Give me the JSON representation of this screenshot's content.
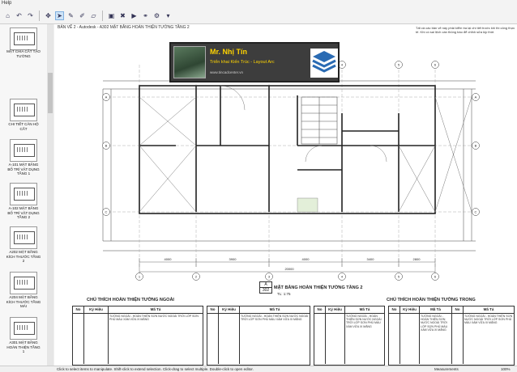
{
  "menu": {
    "help": "Help"
  },
  "toolbar": {
    "icons": [
      "home-icon",
      "back-icon",
      "forward-icon",
      "pan-icon",
      "select-icon",
      "pen-icon",
      "brush-icon",
      "eraser-icon",
      "image-icon",
      "delete-icon",
      "play-icon",
      "link-icon",
      "settings-icon"
    ]
  },
  "sidebar": {
    "thumbnails": [
      {
        "caption": ""
      },
      {
        "caption": "MẶT CHIA CẮT TẠO TƯỜNG"
      },
      {
        "caption": "CHI TIẾT CĂN HỘ CẤT"
      },
      {
        "caption": "A-101 MẶT BẰNG BỐ TRÍ VẬT DỤNG TẦNG 1"
      },
      {
        "caption": "A-102 MẶT BẰNG BỐ TRÍ VẬT DỤNG TẦNG 2"
      },
      {
        "caption": "A202 MẶT BẰNG KÍCH THƯỚC TẦNG 2"
      },
      {
        "caption": "A204 MẶT BẰNG KÍCH THƯỚC TẦNG MÁI"
      },
      {
        "caption": "A301 MẶT BẰNG HOÀN THIỆN TẦNG 1"
      }
    ]
  },
  "canvas": {
    "tab_label": "BẢN VẼ 2 - Autodesk - A302 MẶT BẰNG HOÀN THIỆN TƯỜNG TẦNG 2"
  },
  "banner": {
    "name": "Mr. Nhị Tín",
    "role": "Triển khai Kiến Trúc - Layout Arc",
    "site": "www.tincadcenter.vn"
  },
  "sheet": {
    "code": "A",
    "number": "302",
    "title": "MẶT BẰNG HOÀN THIỆN TƯỜNG TẦNG 2",
    "scale": "TL: 1:75"
  },
  "grid": {
    "columns": [
      "1",
      "2",
      "3",
      "4",
      "5",
      "6"
    ],
    "rows": [
      "A",
      "B",
      "C"
    ],
    "dims_bottom": [
      "4000",
      "3900",
      "4000",
      "3400",
      "2800",
      "1200",
      "2100"
    ],
    "total": "20000"
  },
  "annotation": "Tất cả các bản vẽ này phải kiểm tra lại chi tiết trước khi thi công thực tế. Khi có sai lệch cần thông báo để chỉnh sửa kịp thời.",
  "legend": {
    "outer_title": "CHÚ THÍCH HOÀN THIỆN TƯỜNG NGOÀI",
    "inner_title": "CHÚ THÍCH HOÀN THIỆN TƯỜNG TRONG",
    "headers": [
      "No",
      "Ký Hiệu",
      "Mã Tả"
    ],
    "sample_text": "TƯỜNG NGOÀI - HOÀN THIỆN SƠN NƯỚC NGOÀI TRỜI LỚP SƠN PHỦ MÀU XÁM VỮA XI MĂNG"
  },
  "status": {
    "message": "Click to select items to manipulate. Shift-click to extend selection. Click-drag to select multiple. Double-click to open editor.",
    "unit": "Measurements",
    "zoom": "100%"
  }
}
